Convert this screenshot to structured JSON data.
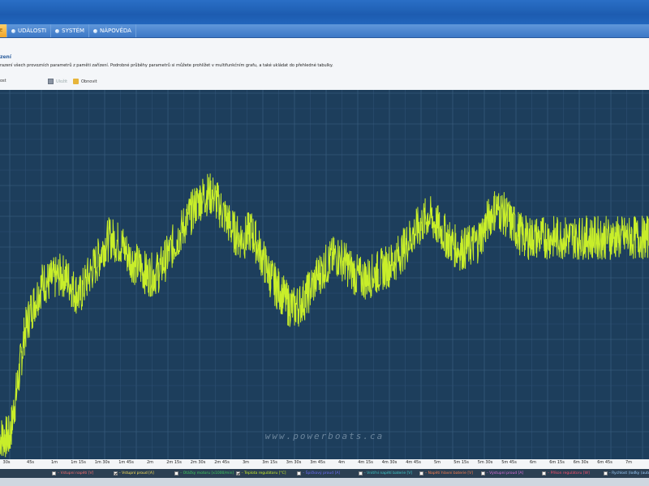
{
  "tabs": [
    {
      "label": "E",
      "active": true
    },
    {
      "label": "UDÁLOSTI",
      "active": false
    },
    {
      "label": "SYSTÉM",
      "active": false
    },
    {
      "label": "NÁPOVĚDA",
      "active": false
    }
  ],
  "info": {
    "title": "zení",
    "description": "razení všech provozních parametrů z paměti zařízení. Podrobné průběhy parametrů si můžete prohlížet v multifunkčním grafu, a také ukládat do přehledné tabulky."
  },
  "toolbar": {
    "left_label": "ost",
    "save_label": "Uložit",
    "refresh_label": "Obnovit"
  },
  "chart_data": {
    "type": "line",
    "x_ticks": [
      "30s",
      "45s",
      "1m",
      "1m 15s",
      "1m 30s",
      "1m 45s",
      "2m",
      "2m 15s",
      "2m 30s",
      "2m 45s",
      "3m",
      "3m 15s",
      "3m 30s",
      "3m 45s",
      "4m",
      "4m 15s",
      "4m 30s",
      "4m 45s",
      "5m",
      "5m 15s",
      "5m 30s",
      "5m 45s",
      "6m",
      "6m 15s",
      "6m 30s",
      "6m 45s",
      "7m"
    ],
    "series": [
      {
        "name": "Teplota regulátoru [°C]",
        "color": "#c8ee2a",
        "x": [
          0,
          4,
          8,
          12,
          16,
          20,
          25,
          30,
          35,
          40,
          45,
          50,
          55,
          60,
          65,
          70,
          75,
          80,
          85,
          90,
          95,
          100,
          105,
          110,
          115,
          120,
          125,
          130,
          135,
          140,
          145,
          150,
          155,
          160,
          165,
          170,
          175,
          180,
          185,
          190,
          195,
          200,
          205,
          210,
          215,
          220,
          225,
          230,
          235,
          240,
          245,
          250,
          255,
          260,
          265,
          270,
          275,
          280,
          285,
          290,
          295,
          300,
          305,
          310,
          315,
          320,
          325,
          330,
          335,
          340,
          345,
          350,
          355,
          360,
          365,
          370,
          375,
          380,
          385,
          390,
          395,
          400,
          405,
          410,
          415,
          420,
          425,
          430,
          435,
          440,
          445,
          450,
          455,
          460,
          465,
          470,
          475,
          480,
          485,
          490,
          495,
          500,
          505,
          510,
          515,
          520,
          525,
          530
        ],
        "y": [
          6,
          6,
          6,
          15,
          24,
          34,
          40,
          44,
          48,
          48,
          49,
          50,
          49,
          46,
          44,
          48,
          51,
          54,
          58,
          60,
          59,
          58,
          55,
          53,
          52,
          50,
          50,
          51,
          54,
          57,
          60,
          63,
          66,
          69,
          71,
          72,
          71,
          68,
          65,
          62,
          60,
          60,
          62,
          58,
          54,
          50,
          47,
          45,
          42,
          41,
          42,
          44,
          47,
          50,
          52,
          54,
          55,
          54,
          52,
          50,
          49,
          49,
          50,
          51,
          52,
          53,
          55,
          57,
          60,
          62,
          64,
          66,
          64,
          62,
          60,
          58,
          57,
          57,
          58,
          59,
          62,
          66,
          68,
          67,
          65,
          63,
          61,
          60,
          60,
          60,
          60,
          60,
          60,
          60,
          60,
          60,
          60,
          60,
          60,
          60,
          60,
          60,
          60,
          60,
          60,
          60,
          60,
          60
        ]
      }
    ],
    "legend": [
      {
        "label": "Vstupní napětí [V]",
        "color": "#ff7070",
        "checked": false
      },
      {
        "label": "Vstupní proud [A]",
        "color": "#ffe45a",
        "checked": true
      },
      {
        "label": "Otáčky motoru [x1000/min]",
        "color": "#40d060",
        "checked": false
      },
      {
        "label": "Teplota regulátoru [°C]",
        "color": "#c8ee2a",
        "checked": true
      },
      {
        "label": "Špičkový proud [A]",
        "color": "#7070ff",
        "checked": false
      },
      {
        "label": "Vnitřní napětí baterie [V]",
        "color": "#40d0d0",
        "checked": false
      },
      {
        "label": "Napětí hlavní baterie [V]",
        "color": "#ff8050",
        "checked": false
      },
      {
        "label": "Výstupní proud [A]",
        "color": "#e070e0",
        "checked": false
      },
      {
        "label": "Příkon regulátoru [W]",
        "color": "#ff5070",
        "checked": false
      },
      {
        "label": "Rychlost (loďky (auto)",
        "color": "#9fd0ff",
        "checked": false
      }
    ],
    "ylim": [
      0,
      100
    ],
    "grid": true
  },
  "watermark": "www.powerboats.ca"
}
